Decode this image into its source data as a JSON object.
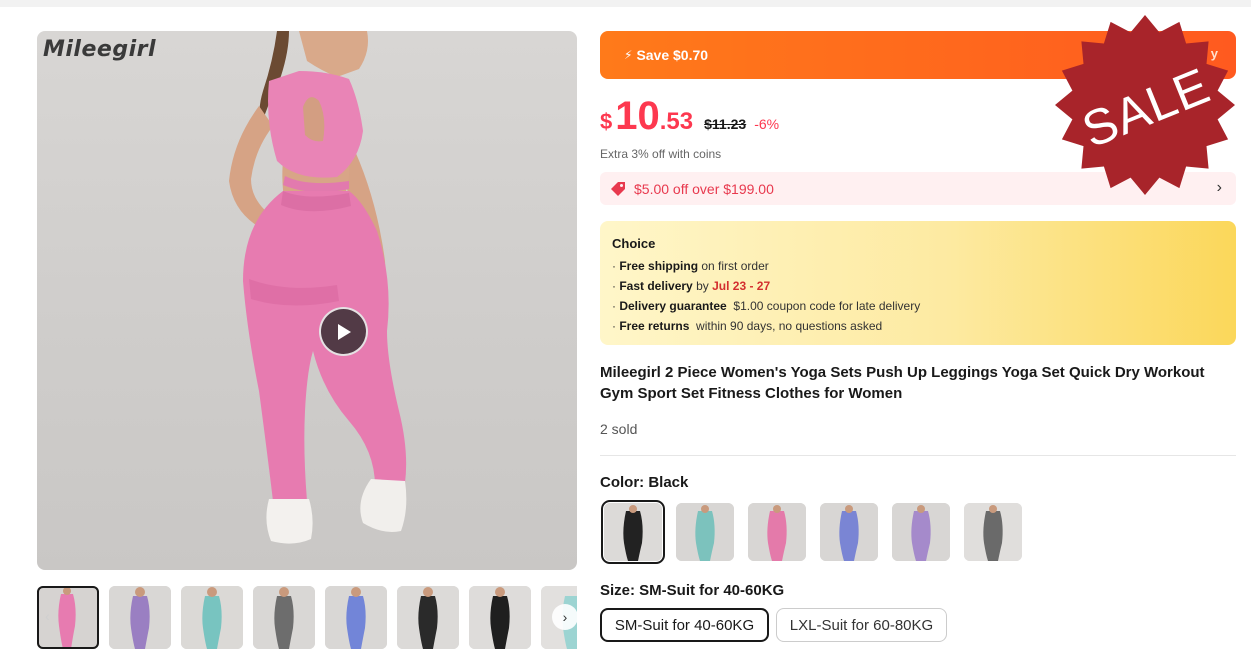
{
  "gallery": {
    "brand_logo": "Mileegirl",
    "thumbnails": [
      {
        "tint": "#e77bb0",
        "active": true
      },
      {
        "tint": "#9a7fc2",
        "active": false
      },
      {
        "tint": "#78c4c0",
        "active": false
      },
      {
        "tint": "#6d6d6d",
        "active": false
      },
      {
        "tint": "#7285d8",
        "active": false
      },
      {
        "tint": "#2a2a2a",
        "active": false
      },
      {
        "tint": "#1f1f1f",
        "active": false
      },
      {
        "tint": "#9cd4d2",
        "active": false
      }
    ],
    "next_arrow": "›",
    "prev_arrow": "‹"
  },
  "promo": {
    "save_label": "Save $0.70",
    "right_label": "y"
  },
  "price": {
    "currency": "$",
    "integer": "10",
    "decimal": ".53",
    "original": "$11.23",
    "discount": "-6%"
  },
  "coins_note": "Extra 3% off with coins",
  "coupon": {
    "text": "$5.00 off over $199.00",
    "chevron": "›"
  },
  "choice": {
    "title": "Choice",
    "lines": [
      {
        "bold": "Free shipping",
        "rest": "on first order"
      },
      {
        "bold": "Fast delivery",
        "mid": "by",
        "highlight": "Jul 23 - 27"
      },
      {
        "bold": "Delivery guarantee",
        "rest": "$1.00 coupon code for late delivery"
      },
      {
        "bold": "Free returns",
        "rest": "within 90 days, no questions asked"
      }
    ]
  },
  "product": {
    "title": "Mileegirl 2 Piece Women's Yoga Sets Push Up Leggings Yoga Set Quick Dry Workout Gym Sport Set Fitness Clothes for Women",
    "sold": "2 sold"
  },
  "color": {
    "label": "Color: Black",
    "swatches": [
      {
        "tint": "#222222",
        "selected": true
      },
      {
        "tint": "#7cc2bd",
        "selected": false
      },
      {
        "tint": "#e47aaa",
        "selected": false
      },
      {
        "tint": "#7a85d4",
        "selected": false
      },
      {
        "tint": "#a58acb",
        "selected": false
      },
      {
        "tint": "#6a6a6a",
        "selected": false
      }
    ]
  },
  "size": {
    "label": "Size: SM-Suit for 40-60KG",
    "options": [
      {
        "label": "SM-Suit for 40-60KG",
        "selected": true
      },
      {
        "label": "LXL-Suit for 60-80KG",
        "selected": false
      }
    ]
  },
  "sale_badge": {
    "text": "SALE",
    "color": "#a8242a"
  }
}
